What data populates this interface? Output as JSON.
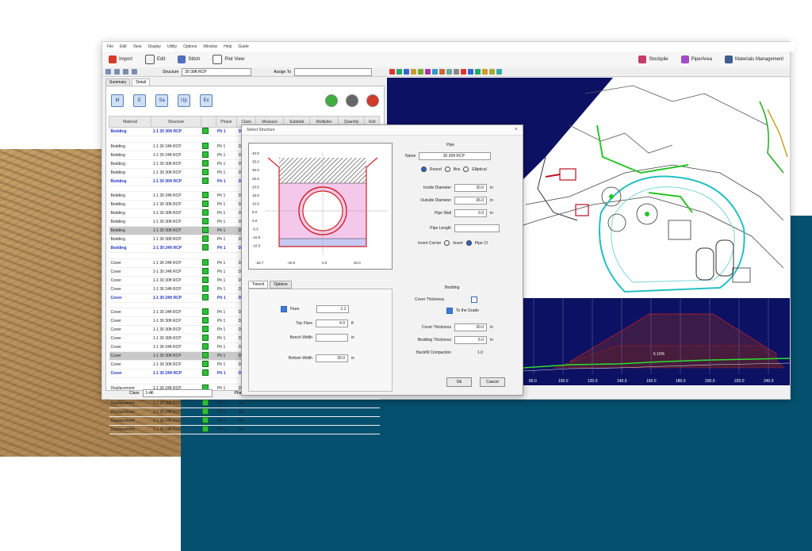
{
  "menu": [
    "File",
    "Edit",
    "View",
    "Display",
    "Utility",
    "Options",
    "Window",
    "Help",
    "Guide"
  ],
  "toolbar": {
    "buttons": [
      {
        "label": "Import",
        "icon": "import-icon"
      },
      {
        "label": "Edit",
        "icon": "edit-icon"
      },
      {
        "label": "Stitch",
        "icon": "stitch-icon"
      },
      {
        "label": "Plot View",
        "icon": "plot-view-icon"
      }
    ],
    "right_buttons": [
      {
        "label": "Stockpile",
        "icon": "stockpile-icon"
      },
      {
        "label": "Pipe/Area",
        "icon": "pipe-area-icon"
      },
      {
        "label": "Materials Management",
        "icon": "materials-icon"
      }
    ]
  },
  "toolbar2": {
    "structure_label": "Structure",
    "structure_value": "30 30ft RCP",
    "assign_label": "Assign To"
  },
  "left_tabs": [
    "Summary",
    "Detail"
  ],
  "left_panel": {
    "icon_buttons": [
      "M",
      "E",
      "Sa",
      "Up",
      "Ex"
    ],
    "columns": [
      "Material",
      "Structure",
      "",
      "Phase",
      "Class",
      "Measure",
      "Subtotal",
      "Multiplier",
      "Quantity",
      "Unit"
    ],
    "rows": [
      {
        "material": "Bedding",
        "structure": "1-1 30 30ft RCP",
        "phase": "Ph 1",
        "class": "Div",
        "type": "hdr"
      },
      {
        "material": "",
        "structure": "",
        "phase": "",
        "class": "",
        "type": "blank"
      },
      {
        "material": "Bedding",
        "structure": "1-1 30 24ft RCP",
        "phase": "Ph 1",
        "class": "Div",
        "type": "row"
      },
      {
        "material": "Bedding",
        "structure": "1-1 30 24ft RCP",
        "phase": "Ph 1",
        "class": "Div",
        "type": "row"
      },
      {
        "material": "Bedding",
        "structure": "1-1 30 30ft RCP",
        "phase": "Ph 1",
        "class": "Div",
        "type": "row"
      },
      {
        "material": "Bedding",
        "structure": "1-1 30 30ft RCP",
        "phase": "Ph 1",
        "class": "Div",
        "type": "row"
      },
      {
        "material": "Bedding",
        "structure": "1-1 30 30ft RCP",
        "phase": "Ph 1",
        "class": "Div",
        "type": "hdr"
      },
      {
        "material": "",
        "structure": "",
        "phase": "",
        "class": "",
        "type": "blank"
      },
      {
        "material": "Bedding",
        "structure": "1-1 30 24ft RCP",
        "phase": "Ph 1",
        "class": "Div",
        "type": "row"
      },
      {
        "material": "Bedding",
        "structure": "1-1 30 30ft RCP",
        "phase": "Ph 1",
        "class": "Div",
        "type": "row"
      },
      {
        "material": "Bedding",
        "structure": "1-1 30 30ft RCP",
        "phase": "Ph 1",
        "class": "Div",
        "type": "row"
      },
      {
        "material": "Bedding",
        "structure": "1-1 30 30ft RCP",
        "phase": "Ph 1",
        "class": "Div",
        "type": "row"
      },
      {
        "material": "Bedding",
        "structure": "1-1 30 30ft RCP",
        "phase": "Ph 1",
        "class": "Div",
        "type": "hl"
      },
      {
        "material": "Bedding",
        "structure": "1-1 30 30ft RCP",
        "phase": "Ph 1",
        "class": "Div",
        "type": "row"
      },
      {
        "material": "Bedding",
        "structure": "1-1 30 24ft RCP",
        "phase": "Ph 1",
        "class": "Div",
        "type": "hdr"
      },
      {
        "material": "",
        "structure": "",
        "phase": "",
        "class": "",
        "type": "blank"
      },
      {
        "material": "Cover",
        "structure": "1-1 30 24ft RCP",
        "phase": "Ph 1",
        "class": "Div",
        "type": "row"
      },
      {
        "material": "Cover",
        "structure": "1-1 30 24ft RCP",
        "phase": "Ph 1",
        "class": "Div",
        "type": "row"
      },
      {
        "material": "Cover",
        "structure": "1-1 30 30ft RCP",
        "phase": "Ph 1",
        "class": "Div",
        "type": "row"
      },
      {
        "material": "Cover",
        "structure": "1-1 30 24ft RCP",
        "phase": "Ph 1",
        "class": "Div",
        "type": "row"
      },
      {
        "material": "Cover",
        "structure": "1-1 30 24ft RCP",
        "phase": "Ph 1",
        "class": "Div",
        "type": "hdr"
      },
      {
        "material": "",
        "structure": "",
        "phase": "",
        "class": "",
        "type": "blank"
      },
      {
        "material": "Cover",
        "structure": "1-1 30 24ft RCP",
        "phase": "Ph 1",
        "class": "Div",
        "type": "row"
      },
      {
        "material": "Cover",
        "structure": "1-1 30 30ft RCP",
        "phase": "Ph 1",
        "class": "Div",
        "type": "row"
      },
      {
        "material": "Cover",
        "structure": "1-1 30 30ft RCP",
        "phase": "Ph 1",
        "class": "Div",
        "type": "row"
      },
      {
        "material": "Cover",
        "structure": "1-1 30 30ft RCP",
        "phase": "Ph 1",
        "class": "Div",
        "type": "row"
      },
      {
        "material": "Cover",
        "structure": "1-1 30 24ft RCP",
        "phase": "Ph 1",
        "class": "Div",
        "type": "row"
      },
      {
        "material": "Cover",
        "structure": "1-1 30 30ft RCP",
        "phase": "Ph 1",
        "class": "Div",
        "type": "hl"
      },
      {
        "material": "Cover",
        "structure": "1-1 30 30ft RCP",
        "phase": "Ph 1",
        "class": "Div",
        "type": "row"
      },
      {
        "material": "Cover",
        "structure": "1-1 30 24ft RCP",
        "phase": "Ph 1",
        "class": "Div",
        "type": "hdr"
      },
      {
        "material": "",
        "structure": "",
        "phase": "",
        "class": "",
        "type": "blank"
      },
      {
        "material": "Displacement",
        "structure": "1-1 30 24ft RCP",
        "phase": "Ph 1",
        "class": "Div",
        "type": "row"
      },
      {
        "material": "",
        "structure": "",
        "phase": "",
        "class": "",
        "type": "blank"
      },
      {
        "material": "Displacement",
        "structure": "1-1 30 30ft RCP",
        "phase": "Ph 1",
        "class": "Div",
        "type": "row"
      },
      {
        "material": "Displacement",
        "structure": "1-1 30 24ft RCP",
        "phase": "Ph 1",
        "class": "Div",
        "type": "row"
      },
      {
        "material": "Displacement",
        "structure": "1-1 30 24ft RCP",
        "phase": "Ph 1",
        "class": "Div",
        "type": "row"
      },
      {
        "material": "Displacement",
        "structure": "1-1 30 24ft RCP",
        "phase": "Ph 1",
        "class": "Div",
        "type": "row"
      }
    ],
    "bottom": {
      "class_label": "Class",
      "class_value": "1-All",
      "phase_label": "Phase"
    }
  },
  "dialog": {
    "title": "Select Structure",
    "close": "×",
    "xsec_y_ticks": [
      "40.0",
      "35.0",
      "30.0",
      "25.0",
      "20.0",
      "15.0",
      "10.0",
      "5.0",
      "0.0",
      "-5.0",
      "-10.0",
      "-15.0"
    ],
    "xsec_x_ticks": [
      "-33.7",
      "-20.0",
      "0.0",
      "20.0"
    ],
    "tabs": [
      "Trench",
      "Options"
    ],
    "trench": {
      "flare_label": "Flare",
      "flare_value": "1:1",
      "top_flare_label": "Top Flare",
      "top_flare_value": "4.0",
      "top_flare_unit": "ft",
      "bench_width_label": "Bench Width",
      "bench_width_unit": "in",
      "bottom_width_label": "Bottom Width",
      "bottom_width_value": "30.0",
      "bottom_width_unit": "in"
    },
    "pipe": {
      "section_title": "Pipe",
      "name_label": "Name",
      "name_value": "30 30ft RCP",
      "shape_options": [
        "Round",
        "Box",
        "Elliptical"
      ],
      "inside_diameter_label": "Inside Diameter",
      "inside_diameter_value": "30.0",
      "inside_diameter_unit": "in",
      "outside_diameter_label": "Outside Diameter",
      "outside_diameter_value": "36.0",
      "outside_diameter_unit": "in",
      "pipe_wall_label": "Pipe Wall",
      "pipe_wall_value": "3.0",
      "pipe_wall_unit": "in",
      "pipe_length_label": "Pipe Length",
      "invert_label": "Invert Corner",
      "invert_options": [
        "Invert",
        "Pipe Cl"
      ]
    },
    "bedding": {
      "section_title": "Bedding",
      "cover_thick_label": "Cover Thickness",
      "to_grade_label": "To the Grade",
      "cover_label": "Cover Thickness",
      "cover_value": "30.0",
      "cover_unit": "in",
      "bedding_label": "Bedding Thickness",
      "bedding_value": "6.0",
      "bedding_unit": "in",
      "backfill_label": "Backfill Compaction",
      "backfill_value": "1.0"
    },
    "ok_label": "Ok",
    "cancel_label": "Cancel"
  },
  "profile_x_ticks": [
    "80.0",
    "100.0",
    "120.0",
    "140.0",
    "160.0",
    "180.0",
    "200.0",
    "220.0",
    "240.0"
  ],
  "profile_label": "5.10%",
  "colors": {
    "blue_panel": "#06506f",
    "cad_navy": "#0c1163",
    "pipe_red": "#d22020",
    "trench_pink": "#f3c8ea"
  }
}
